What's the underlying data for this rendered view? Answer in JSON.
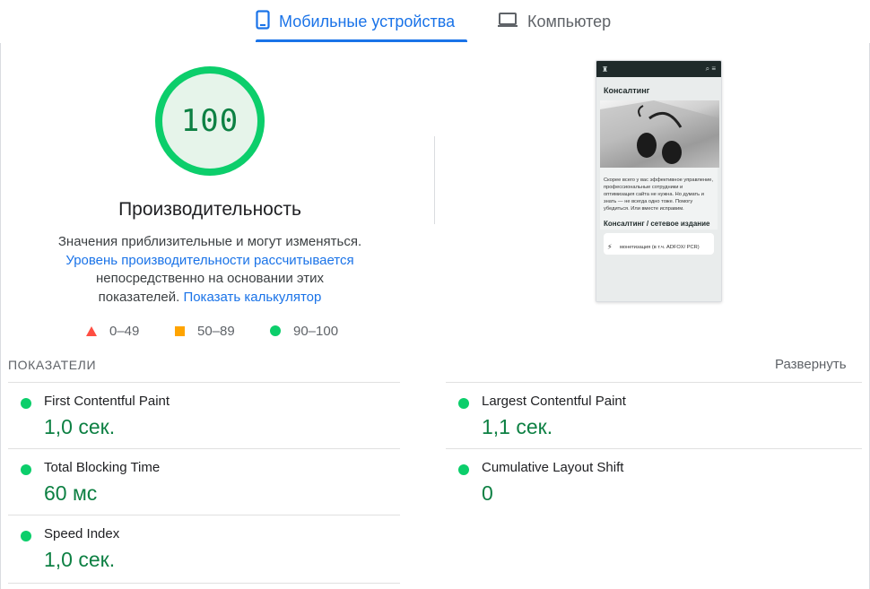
{
  "tabs": {
    "mobile_label": "Мобильные устройства",
    "desktop_label": "Компьютер",
    "active": "mobile"
  },
  "score": {
    "value": "100",
    "title": "Производительность",
    "color": "#0cce6b"
  },
  "description": {
    "line1": "Значения приблизительные и могут изменяться.",
    "link1": "Уровень производительности рассчитывается",
    "line2": "непосредственно на основании этих",
    "line3": "показателей.",
    "link2": "Показать калькулятор"
  },
  "legend": [
    {
      "range": "0–49",
      "shape": "triangle",
      "color": "#ff4e42"
    },
    {
      "range": "50–89",
      "shape": "square",
      "color": "#ffa400"
    },
    {
      "range": "90–100",
      "shape": "circle",
      "color": "#0cce6b"
    }
  ],
  "preview": {
    "heading": "Консалтинг",
    "paragraph": "Скорее всего у вас эффективное управление, профессиональные сотрудники и оптимизация сайта не нужна. Но думать и знать — не всегда одно тоже. Помогу убедиться. Или вместе исправим.",
    "subheading": "Консалтинг / сетевое издание",
    "card_text": "монетизация (в т.ч. ADFOX/ PCR)"
  },
  "metrics": {
    "section_label": "ПОКАЗАТЕЛИ",
    "expand_label": "Развернуть",
    "items": [
      {
        "name": "First Contentful Paint",
        "value": "1,0 сек.",
        "status": "good"
      },
      {
        "name": "Largest Contentful Paint",
        "value": "1,1 сек.",
        "status": "good"
      },
      {
        "name": "Total Blocking Time",
        "value": "60 мс",
        "status": "good"
      },
      {
        "name": "Cumulative Layout Shift",
        "value": "0",
        "status": "good"
      },
      {
        "name": "Speed Index",
        "value": "1,0 сек.",
        "status": "good"
      }
    ]
  },
  "colors": {
    "accent": "#1a73e8",
    "good": "#0cce6b",
    "good_text": "#0d8043",
    "average": "#ffa400",
    "poor": "#ff4e42"
  }
}
